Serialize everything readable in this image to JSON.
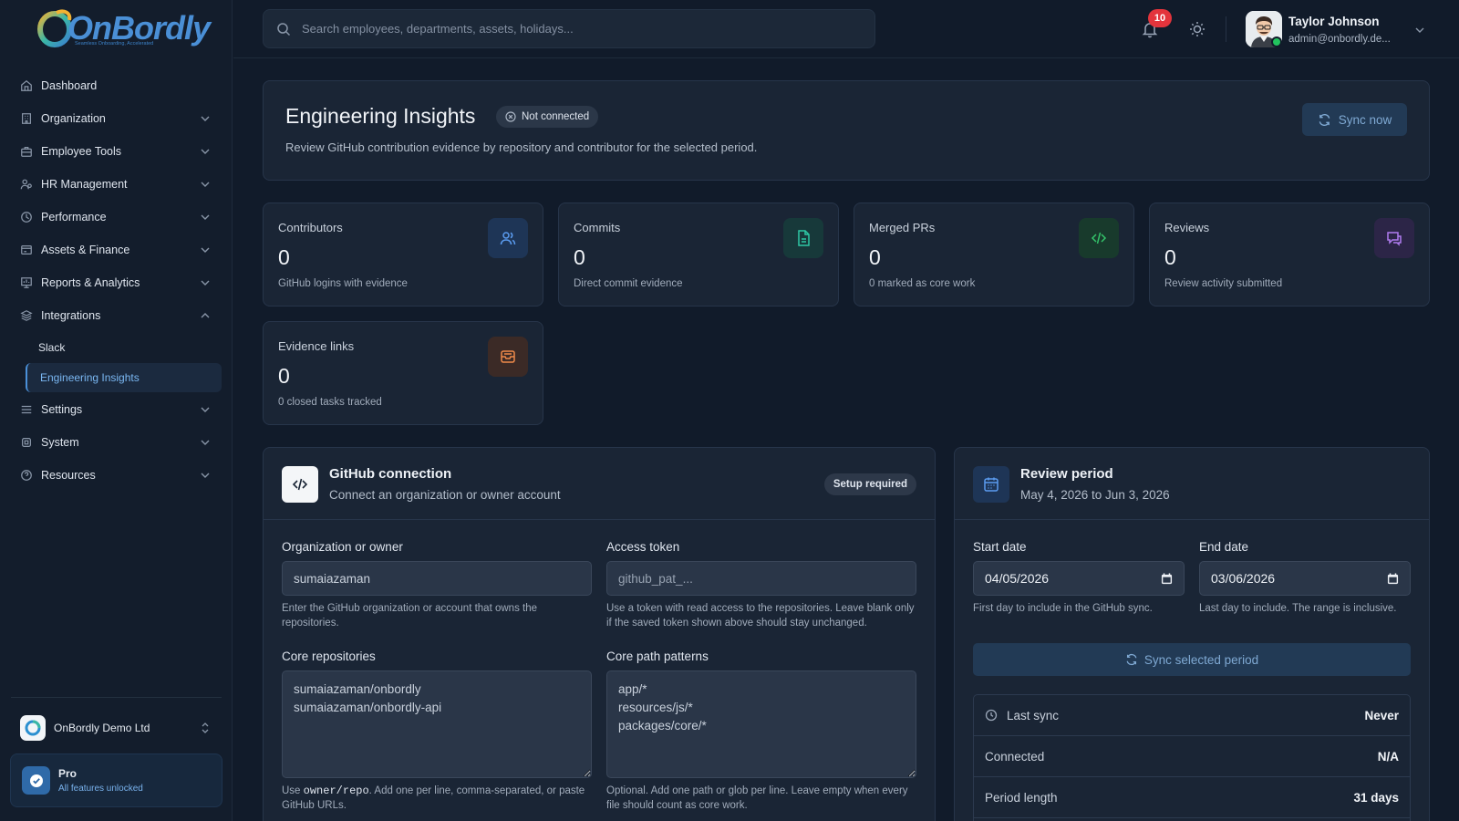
{
  "brand": {
    "logo_text": "OnBordly",
    "tagline": "Seamless Onboarding, Accelerated"
  },
  "sidebar": {
    "items": [
      {
        "label": "Dashboard",
        "icon": "home-icon",
        "expandable": false
      },
      {
        "label": "Organization",
        "icon": "building-icon",
        "expandable": true
      },
      {
        "label": "Employee Tools",
        "icon": "briefcase-icon",
        "expandable": true
      },
      {
        "label": "HR Management",
        "icon": "users-cog-icon",
        "expandable": true
      },
      {
        "label": "Performance",
        "icon": "trend-icon",
        "expandable": true
      },
      {
        "label": "Assets & Finance",
        "icon": "wallet-icon",
        "expandable": true
      },
      {
        "label": "Reports & Analytics",
        "icon": "report-icon",
        "expandable": true
      },
      {
        "label": "Integrations",
        "icon": "layers-icon",
        "expandable": true,
        "expanded": true
      },
      {
        "label": "Settings",
        "icon": "sliders-icon",
        "expandable": true
      },
      {
        "label": "System",
        "icon": "cpu-icon",
        "expandable": true
      },
      {
        "label": "Resources",
        "icon": "help-icon",
        "expandable": true
      }
    ],
    "integrations_sub": [
      "Slack",
      "Engineering Insights"
    ],
    "active_sub": "Engineering Insights",
    "company": "OnBordly Demo Ltd",
    "plan": {
      "title": "Pro",
      "subtitle": "All features unlocked"
    }
  },
  "topbar": {
    "search_placeholder": "Search employees, departments, assets, holidays...",
    "notification_count": "10",
    "user": {
      "name": "Taylor Johnson",
      "email": "admin@onbordly.de..."
    }
  },
  "header": {
    "title": "Engineering Insights",
    "status": "Not connected",
    "description": "Review GitHub contribution evidence by repository and contributor for the selected period.",
    "sync_button": "Sync now"
  },
  "stats": [
    {
      "label": "Contributors",
      "value": "0",
      "sub": "GitHub logins with evidence",
      "icon": "users-icon",
      "color": "#5b9cf0",
      "bg": "#1e3556"
    },
    {
      "label": "Commits",
      "value": "0",
      "sub": "Direct commit evidence",
      "icon": "file-icon",
      "color": "#2ec7a5",
      "bg": "#17393a"
    },
    {
      "label": "Merged PRs",
      "value": "0",
      "sub": "0 marked as core work",
      "icon": "code-icon",
      "color": "#34c46a",
      "bg": "#183a2c"
    },
    {
      "label": "Reviews",
      "value": "0",
      "sub": "Review activity submitted",
      "icon": "chat-icon",
      "color": "#b07cf0",
      "bg": "#2c2547"
    },
    {
      "label": "Evidence links",
      "value": "0",
      "sub": "0 closed tasks tracked",
      "icon": "inbox-icon",
      "color": "#f08a4a",
      "bg": "#3b2a26"
    }
  ],
  "github": {
    "title": "GitHub connection",
    "subtitle": "Connect an organization or owner account",
    "badge": "Setup required",
    "org_label": "Organization or owner",
    "org_value": "sumaiazaman",
    "org_help": "Enter the GitHub organization or account that owns the repositories.",
    "token_label": "Access token",
    "token_placeholder": "github_pat_...",
    "token_help": "Use a token with read access to the repositories. Leave blank only if the saved token shown above should stay unchanged.",
    "repos_label": "Core repositories",
    "repos_value": "sumaiazaman/onbordly\nsumaiazaman/onbordly-api",
    "repos_help_pre": "Use ",
    "repos_help_code": "owner/repo",
    "repos_help_post": ". Add one per line, comma-separated, or paste GitHub URLs.",
    "paths_label": "Core path patterns",
    "paths_value": "app/*\nresources/js/*\npackages/core/*",
    "paths_help": "Optional. Add one path or glob per line. Leave empty when every file should count as core work."
  },
  "review": {
    "title": "Review period",
    "subtitle": "May 4, 2026 to Jun 3, 2026",
    "start_label": "Start date",
    "start_value": "04/05/2026",
    "start_help": "First day to include in the GitHub sync.",
    "end_label": "End date",
    "end_value": "03/06/2026",
    "end_help": "Last day to include. The range is inclusive.",
    "sync_button": "Sync selected period",
    "rows": [
      {
        "key": "Last sync",
        "value": "Never"
      },
      {
        "key": "Connected",
        "value": "N/A"
      },
      {
        "key": "Period length",
        "value": "31 days"
      }
    ]
  }
}
